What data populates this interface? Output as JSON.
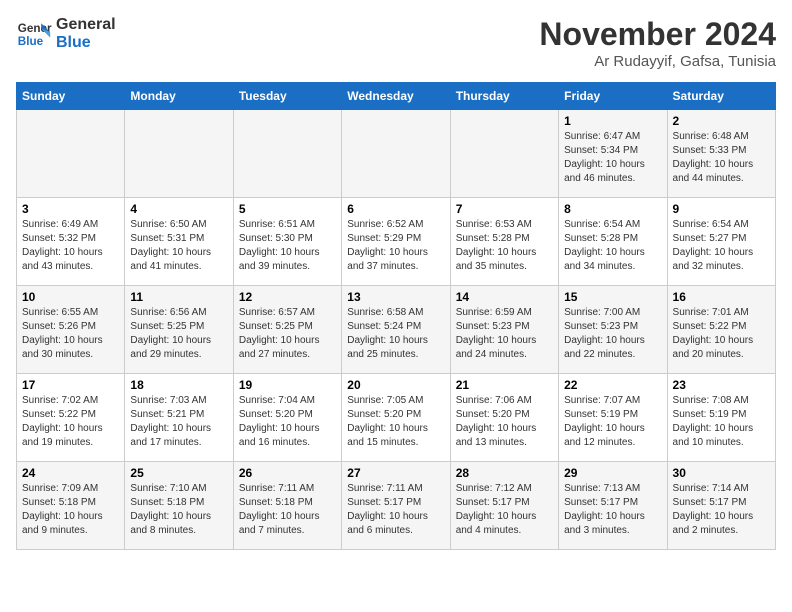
{
  "logo": {
    "line1": "General",
    "line2": "Blue"
  },
  "title": "November 2024",
  "location": "Ar Rudayyif, Gafsa, Tunisia",
  "weekdays": [
    "Sunday",
    "Monday",
    "Tuesday",
    "Wednesday",
    "Thursday",
    "Friday",
    "Saturday"
  ],
  "weeks": [
    [
      {
        "day": "",
        "info": ""
      },
      {
        "day": "",
        "info": ""
      },
      {
        "day": "",
        "info": ""
      },
      {
        "day": "",
        "info": ""
      },
      {
        "day": "",
        "info": ""
      },
      {
        "day": "1",
        "info": "Sunrise: 6:47 AM\nSunset: 5:34 PM\nDaylight: 10 hours and 46 minutes."
      },
      {
        "day": "2",
        "info": "Sunrise: 6:48 AM\nSunset: 5:33 PM\nDaylight: 10 hours and 44 minutes."
      }
    ],
    [
      {
        "day": "3",
        "info": "Sunrise: 6:49 AM\nSunset: 5:32 PM\nDaylight: 10 hours and 43 minutes."
      },
      {
        "day": "4",
        "info": "Sunrise: 6:50 AM\nSunset: 5:31 PM\nDaylight: 10 hours and 41 minutes."
      },
      {
        "day": "5",
        "info": "Sunrise: 6:51 AM\nSunset: 5:30 PM\nDaylight: 10 hours and 39 minutes."
      },
      {
        "day": "6",
        "info": "Sunrise: 6:52 AM\nSunset: 5:29 PM\nDaylight: 10 hours and 37 minutes."
      },
      {
        "day": "7",
        "info": "Sunrise: 6:53 AM\nSunset: 5:28 PM\nDaylight: 10 hours and 35 minutes."
      },
      {
        "day": "8",
        "info": "Sunrise: 6:54 AM\nSunset: 5:28 PM\nDaylight: 10 hours and 34 minutes."
      },
      {
        "day": "9",
        "info": "Sunrise: 6:54 AM\nSunset: 5:27 PM\nDaylight: 10 hours and 32 minutes."
      }
    ],
    [
      {
        "day": "10",
        "info": "Sunrise: 6:55 AM\nSunset: 5:26 PM\nDaylight: 10 hours and 30 minutes."
      },
      {
        "day": "11",
        "info": "Sunrise: 6:56 AM\nSunset: 5:25 PM\nDaylight: 10 hours and 29 minutes."
      },
      {
        "day": "12",
        "info": "Sunrise: 6:57 AM\nSunset: 5:25 PM\nDaylight: 10 hours and 27 minutes."
      },
      {
        "day": "13",
        "info": "Sunrise: 6:58 AM\nSunset: 5:24 PM\nDaylight: 10 hours and 25 minutes."
      },
      {
        "day": "14",
        "info": "Sunrise: 6:59 AM\nSunset: 5:23 PM\nDaylight: 10 hours and 24 minutes."
      },
      {
        "day": "15",
        "info": "Sunrise: 7:00 AM\nSunset: 5:23 PM\nDaylight: 10 hours and 22 minutes."
      },
      {
        "day": "16",
        "info": "Sunrise: 7:01 AM\nSunset: 5:22 PM\nDaylight: 10 hours and 20 minutes."
      }
    ],
    [
      {
        "day": "17",
        "info": "Sunrise: 7:02 AM\nSunset: 5:22 PM\nDaylight: 10 hours and 19 minutes."
      },
      {
        "day": "18",
        "info": "Sunrise: 7:03 AM\nSunset: 5:21 PM\nDaylight: 10 hours and 17 minutes."
      },
      {
        "day": "19",
        "info": "Sunrise: 7:04 AM\nSunset: 5:20 PM\nDaylight: 10 hours and 16 minutes."
      },
      {
        "day": "20",
        "info": "Sunrise: 7:05 AM\nSunset: 5:20 PM\nDaylight: 10 hours and 15 minutes."
      },
      {
        "day": "21",
        "info": "Sunrise: 7:06 AM\nSunset: 5:20 PM\nDaylight: 10 hours and 13 minutes."
      },
      {
        "day": "22",
        "info": "Sunrise: 7:07 AM\nSunset: 5:19 PM\nDaylight: 10 hours and 12 minutes."
      },
      {
        "day": "23",
        "info": "Sunrise: 7:08 AM\nSunset: 5:19 PM\nDaylight: 10 hours and 10 minutes."
      }
    ],
    [
      {
        "day": "24",
        "info": "Sunrise: 7:09 AM\nSunset: 5:18 PM\nDaylight: 10 hours and 9 minutes."
      },
      {
        "day": "25",
        "info": "Sunrise: 7:10 AM\nSunset: 5:18 PM\nDaylight: 10 hours and 8 minutes."
      },
      {
        "day": "26",
        "info": "Sunrise: 7:11 AM\nSunset: 5:18 PM\nDaylight: 10 hours and 7 minutes."
      },
      {
        "day": "27",
        "info": "Sunrise: 7:11 AM\nSunset: 5:17 PM\nDaylight: 10 hours and 6 minutes."
      },
      {
        "day": "28",
        "info": "Sunrise: 7:12 AM\nSunset: 5:17 PM\nDaylight: 10 hours and 4 minutes."
      },
      {
        "day": "29",
        "info": "Sunrise: 7:13 AM\nSunset: 5:17 PM\nDaylight: 10 hours and 3 minutes."
      },
      {
        "day": "30",
        "info": "Sunrise: 7:14 AM\nSunset: 5:17 PM\nDaylight: 10 hours and 2 minutes."
      }
    ]
  ]
}
